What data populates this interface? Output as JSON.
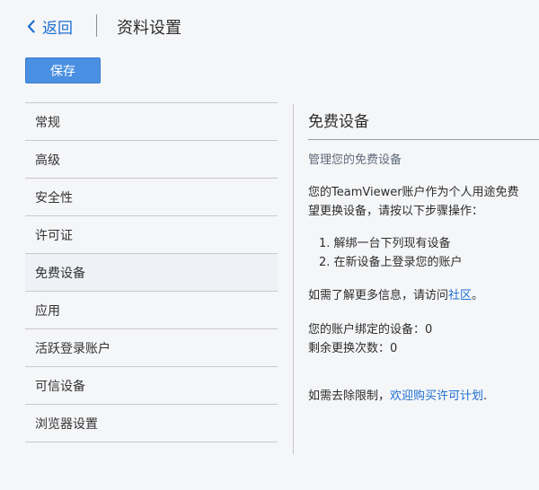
{
  "header": {
    "back_label": "返回",
    "title": "资料设置"
  },
  "toolbar": {
    "save_label": "保存"
  },
  "sidebar": {
    "items": [
      {
        "label": "常规"
      },
      {
        "label": "高级"
      },
      {
        "label": "安全性"
      },
      {
        "label": "许可证"
      },
      {
        "label": "免费设备"
      },
      {
        "label": "应用"
      },
      {
        "label": "活跃登录账户"
      },
      {
        "label": "可信设备"
      },
      {
        "label": "浏览器设置"
      }
    ]
  },
  "content": {
    "title": "免费设备",
    "subheading": "管理您的免费设备",
    "intro_line1": "您的TeamViewer账户作为个人用途免费",
    "intro_line2": "望更换设备，请按以下步骤操作：",
    "steps": [
      "1. 解绑一台下列现有设备",
      "2. 在新设备上登录您的账户"
    ],
    "more_info_prefix": "如需了解更多信息，请访问",
    "more_info_link": "社区",
    "more_info_suffix": "。",
    "bound_devices": "您的账户绑定的设备：0",
    "remaining_swaps": "剩余更换次数：0",
    "limit_prefix": "如需去除限制，",
    "limit_link": "欢迎购买许可计划",
    "limit_suffix": "."
  },
  "colors": {
    "accent": "#4a90e2",
    "link": "#1e6fd0",
    "background": "#f5f6f8",
    "active_item": "#eef1f5"
  },
  "icons": {
    "back": "chevron-left-icon"
  }
}
